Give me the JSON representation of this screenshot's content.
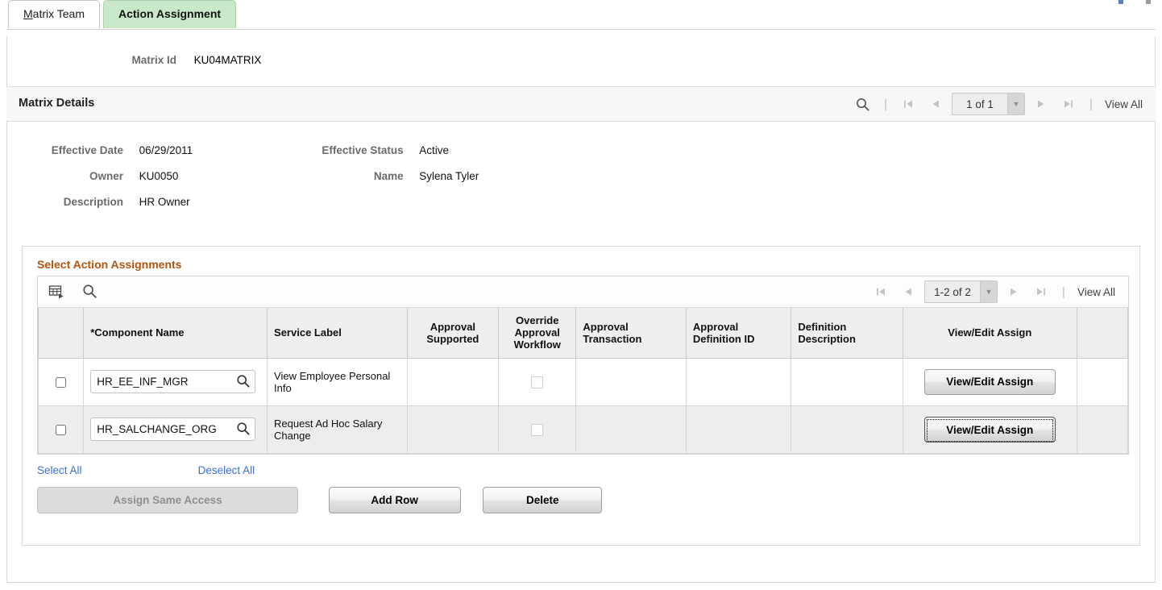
{
  "tabs": [
    {
      "label": "Matrix Team",
      "accesskey": "M",
      "active": false
    },
    {
      "label": "Action Assignment",
      "active": true
    }
  ],
  "key_field": {
    "label": "Matrix Id",
    "value": "KU04MATRIX"
  },
  "matrix_details": {
    "title": "Matrix Details",
    "nav": {
      "search_icon": "search-icon",
      "first_icon": "first-page-icon",
      "prev_icon": "previous-page-icon",
      "counter": "1 of 1",
      "next_icon": "next-page-icon",
      "last_icon": "last-page-icon",
      "view_all": "View All"
    },
    "fields": {
      "effective_date_label": "Effective Date",
      "effective_date_value": "06/29/2011",
      "effective_status_label": "Effective Status",
      "effective_status_value": "Active",
      "owner_label": "Owner",
      "owner_value": "KU0050",
      "name_label": "Name",
      "name_value": "Sylena Tyler",
      "description_label": "Description",
      "description_value": "HR Owner"
    }
  },
  "action_assignments": {
    "title": "Select Action Assignments",
    "toolbar": {
      "personalize_icon": "grid-personalize-icon",
      "find_icon": "search-icon"
    },
    "nav": {
      "first_icon": "first-page-icon",
      "prev_icon": "previous-page-icon",
      "counter": "1-2 of 2",
      "next_icon": "next-page-icon",
      "last_icon": "last-page-icon",
      "view_all": "View All"
    },
    "columns": [
      "",
      "*Component Name",
      "Service Label",
      "Approval Supported",
      "Override Approval Workflow",
      "Approval Transaction",
      "Approval Definition ID",
      "Definition Description",
      "View/Edit Assign",
      ""
    ],
    "rows": [
      {
        "selected": false,
        "component_name": "HR_EE_INF_MGR",
        "service_label": "View Employee Personal Info",
        "approval_supported": "",
        "override_approval_workflow": false,
        "approval_transaction": "",
        "approval_definition_id": "",
        "definition_description": "",
        "view_edit_label": "View/Edit Assign",
        "focused": false
      },
      {
        "selected": false,
        "component_name": "HR_SALCHANGE_ORG",
        "service_label": "Request Ad Hoc Salary Change",
        "approval_supported": "",
        "override_approval_workflow": false,
        "approval_transaction": "",
        "approval_definition_id": "",
        "definition_description": "",
        "view_edit_label": "View/Edit Assign",
        "focused": true
      }
    ],
    "links": {
      "select_all": "Select All",
      "deselect_all": "Deselect All"
    },
    "buttons": {
      "assign_same_access": "Assign Same Access",
      "assign_same_access_disabled": true,
      "add_row": "Add Row",
      "delete": "Delete"
    }
  },
  "colors": {
    "active_tab_bg": "#c9e7c9",
    "group_title": "#b5530d",
    "link": "#3a6fd8",
    "label": "#6b6b6b",
    "header_bg": "#eeeeee",
    "row_alt_bg": "#ededed"
  }
}
